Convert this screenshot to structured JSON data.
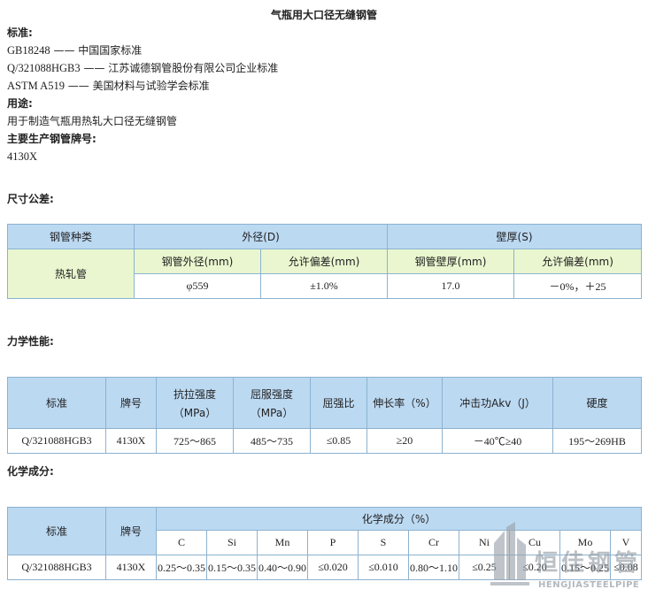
{
  "title": "气瓶用大口径无缝钢管",
  "standards": {
    "label": "标准:",
    "items": [
      {
        "code": "GB18248",
        "sep": " —— ",
        "desc": "中国国家标准"
      },
      {
        "code": "Q/321088HGB3",
        "sep": " —— ",
        "desc": "江苏诚德钢管股份有限公司企业标准"
      },
      {
        "code": "ASTM A519",
        "sep": " —— ",
        "desc": "美国材料与试验学会标准"
      }
    ]
  },
  "usage": {
    "label": "用途:",
    "text": "用于制造气瓶用热轧大口径无缝钢管"
  },
  "grades": {
    "label": "主要生产钢管牌号:",
    "text": "4130X"
  },
  "dim": {
    "label": "尺寸公差:",
    "h_type": "钢管种类",
    "h_od": "外径(D)",
    "h_wt": "壁厚(S)",
    "sub": [
      "钢管外径(mm)",
      "允许偏差(mm)",
      "钢管壁厚(mm)",
      "允许偏差(mm)"
    ],
    "type": "热轧管",
    "row": [
      "φ559",
      "±1.0%",
      "17.0",
      "－0%，＋25"
    ]
  },
  "mech": {
    "label": "力学性能:",
    "headers": [
      {
        "l1": "标准",
        "l2": ""
      },
      {
        "l1": "牌号",
        "l2": ""
      },
      {
        "l1": "抗拉强度",
        "l2": "（MPa）"
      },
      {
        "l1": "屈服强度",
        "l2": "（MPa）"
      },
      {
        "l1": "屈强比",
        "l2": ""
      },
      {
        "l1": "伸长率（%）",
        "l2": ""
      },
      {
        "l1": "冲击功Akv（J）",
        "l2": ""
      },
      {
        "l1": "硬度",
        "l2": ""
      }
    ],
    "row": [
      "Q/321088HGB3",
      "4130X",
      "725～865",
      "485～735",
      "≤0.85",
      "≥20",
      "－40℃≥40",
      "195～269HB"
    ]
  },
  "chem": {
    "label": "化学成分:",
    "h_std": "标准",
    "h_grade": "牌号",
    "h_group": "化学成分（%）",
    "elements": [
      "C",
      "Si",
      "Mn",
      "P",
      "S",
      "Cr",
      "Ni",
      "Cu",
      "Mo",
      "V"
    ],
    "row": [
      "Q/321088HGB3",
      "4130X",
      "0.25～0.35",
      "0.15～0.35",
      "0.40～0.90",
      "≤0.020",
      "≤0.010",
      "0.80～1.10",
      "≤0.25",
      "≤0.20",
      "0.15～0.25",
      "≤0.08"
    ]
  },
  "watermark": {
    "cn": "恒佳钢管",
    "en": "HENGJIASTEELPIPE"
  }
}
